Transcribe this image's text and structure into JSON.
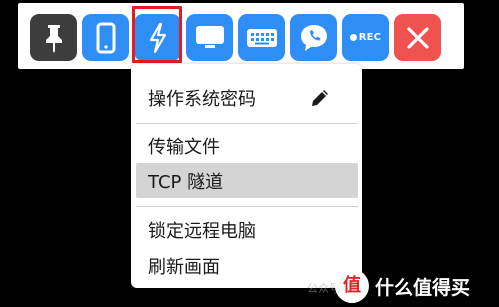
{
  "toolbar": {
    "buttons": [
      {
        "icon": "pin-icon",
        "color": "#3d3d3d"
      },
      {
        "icon": "mobile-icon",
        "color": "#2f8ef5"
      },
      {
        "icon": "lightning-icon",
        "color": "#2f8ef5",
        "highlighted": true
      },
      {
        "icon": "monitor-icon",
        "color": "#2f8ef5"
      },
      {
        "icon": "keyboard-icon",
        "color": "#2f8ef5"
      },
      {
        "icon": "chat-phone-icon",
        "color": "#2f8ef5"
      },
      {
        "icon": "record-icon",
        "color": "#2f8ef5",
        "label": "REC"
      },
      {
        "icon": "close-icon",
        "color": "#f0524f"
      }
    ],
    "highlight_color": "#e31b23"
  },
  "menu": {
    "items": [
      {
        "label": "操作系统密码",
        "icon": "pencil-icon"
      },
      {
        "label": "传输文件"
      },
      {
        "label": "TCP 隧道",
        "selected": true
      },
      {
        "label": "锁定远程电脑"
      },
      {
        "label": "刷新画面"
      }
    ]
  },
  "watermark": {
    "text": "什么值得买",
    "badge": "值",
    "faint": "公众号 · 值"
  }
}
